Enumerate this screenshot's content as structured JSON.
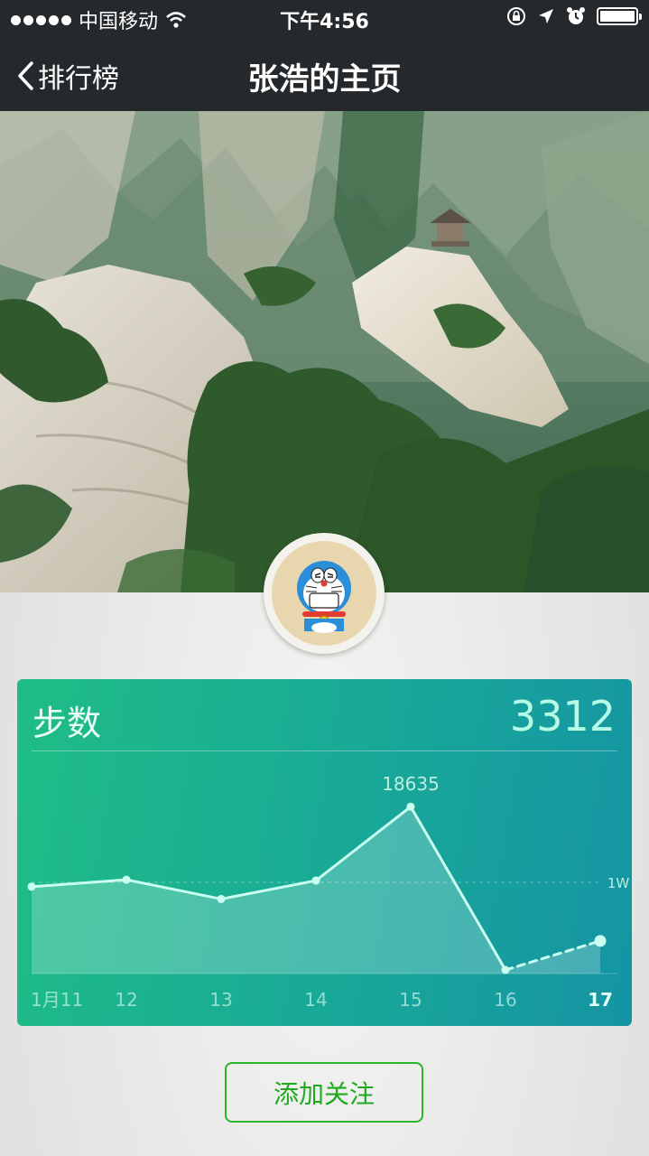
{
  "status_bar": {
    "carrier": "中国移动",
    "time": "下午4:56"
  },
  "nav": {
    "back_label": "排行榜",
    "title": "张浩的主页"
  },
  "card": {
    "title": "步数",
    "value": "3312"
  },
  "chart_data": {
    "type": "line",
    "categories": [
      "1月11",
      "12",
      "13",
      "14",
      "15",
      "16",
      "17"
    ],
    "values": [
      9500,
      10300,
      8100,
      10200,
      18635,
      0,
      3312
    ],
    "ylim": [
      0,
      20000
    ],
    "reference_line": {
      "value": 10000,
      "label": "1W"
    },
    "peak_label": "18635",
    "today_index": 6,
    "colors": {
      "line": "#c9fff0",
      "fill": "rgba(255,255,255,0.22)",
      "label": "#bdeee0"
    }
  },
  "follow_button": {
    "label": "添加关注"
  }
}
